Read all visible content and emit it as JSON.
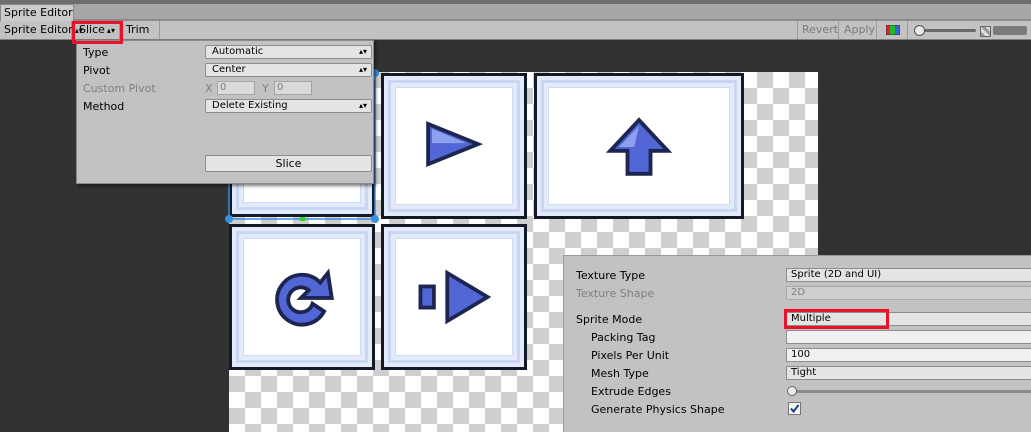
{
  "window": {
    "tab_title": "Sprite Editor"
  },
  "toolbar": {
    "mode_label": "Sprite Editor",
    "slice_label": "Slice",
    "trim_label": "Trim",
    "revert_label": "Revert",
    "apply_label": "Apply"
  },
  "slice_popup": {
    "type_label": "Type",
    "type_value": "Automatic",
    "pivot_label": "Pivot",
    "pivot_value": "Center",
    "custom_pivot_label": "Custom Pivot",
    "x_label": "X",
    "x_value": "0",
    "y_label": "Y",
    "y_value": "0",
    "method_label": "Method",
    "method_value": "Delete Existing",
    "slice_button": "Slice"
  },
  "inspector": {
    "texture_type_label": "Texture Type",
    "texture_type_value": "Sprite (2D and UI)",
    "texture_shape_label": "Texture Shape",
    "texture_shape_value": "2D",
    "sprite_mode_label": "Sprite Mode",
    "sprite_mode_value": "Multiple",
    "packing_tag_label": "Packing Tag",
    "packing_tag_value": "",
    "ppu_label": "Pixels Per Unit",
    "ppu_value": "100",
    "mesh_type_label": "Mesh Type",
    "mesh_type_value": "Tight",
    "extrude_label": "Extrude Edges",
    "extrude_value": 0,
    "physics_label": "Generate Physics Shape",
    "physics_checked": true
  },
  "sprites": [
    "button-icon-sprite",
    "play-icon-sprite",
    "arrow-up-icon-sprite",
    "replay-icon-sprite",
    "forward-step-icon-sprite"
  ],
  "colors": {
    "highlight": "#e8132a",
    "sprite_fill": "#5266d6",
    "selection": "#3b8fe0"
  }
}
